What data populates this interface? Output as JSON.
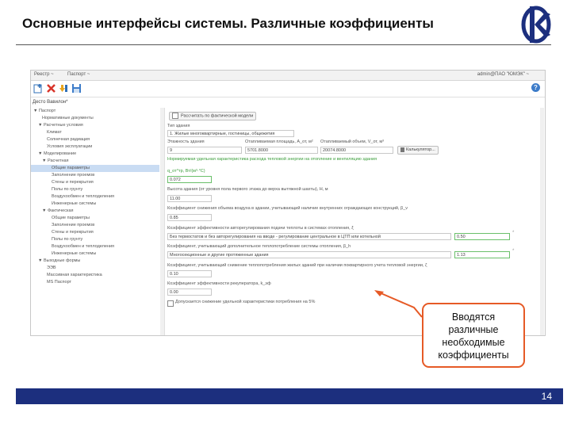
{
  "slide": {
    "title": "Основные интерфейсы системы. Различные коэффициенты",
    "page_number": "14",
    "callout_lines": [
      "Вводятся",
      "различные",
      "необходимые",
      "коэффициенты"
    ],
    "colors": {
      "accent": "#e65a26",
      "footer": "#1c2f7e",
      "logo": "#1c2f7e"
    }
  },
  "app": {
    "top_menu": [
      "Реестр ~",
      "Паспорт ~"
    ],
    "user": "admin@ПАО \"ЮМЭК\" ~",
    "toolbar_icons": [
      "add-icon",
      "delete-icon",
      "edit-icon",
      "save-icon"
    ],
    "document_title": "Десто Вавилон*"
  },
  "tree": [
    "▼ Паспорт",
    "Нормативные документы",
    "▼ Расчетные условия",
    "Климат",
    "Солнечная радиация",
    "Условия эксплуатации",
    "▼ Моделирование",
    "▼ Расчетная",
    "Общие параметры",
    "Заполнение проемов",
    "Стены и перекрытия",
    "Полы по грунту",
    "Воздухообмен и теплоделения",
    "Инженерные системы",
    "▼ Фактическая",
    "Общие параметры",
    "Заполнение проемов",
    "Стены и перекрытия",
    "Полы по грунту",
    "Воздухообмен и теплоделения",
    "Инженерные системы",
    "▼ Выходные формы",
    "ЭЭВ",
    "Массивная характеристика",
    "MS Паспорт"
  ],
  "form": {
    "calc_checkbox": "Рассчитать по фактической модели",
    "building_type_label": "Тип здания",
    "building_type_value": "1. Жилые многоквартирные, гостиницы, общежития",
    "floors_label": "Этажность здания",
    "area_label": "Отапливаемая площадь, A_от, м²",
    "volume_label": "Отапливаемый объем, V_от, м³",
    "floors_value": "9",
    "area_value": "5701.8000",
    "volume_value": "20074.8000",
    "calc_button": "Калькулятор...",
    "norm_label": "Нормируемая удельная характеристика расхода тепловой энергии на отопление и вентиляцию здания",
    "norm_sub": "q_от^тр, Вт/(м³·°С)",
    "norm_value": "0.072",
    "height_label": "Высота здания (от уровня пола первого этажа до верха вытяжной шахты), H, м",
    "height_value": "11.00",
    "coef_volume_label": "Коэффициент снижения объема воздуха в здании, учитывающий наличие внутренних ограждающих конструкций, β_v",
    "coef_volume_value": "0.85",
    "coef_auto_label": "Коэффициент эффективности авторегулирования подачи теплоты в системах отопления, ξ",
    "coef_auto_select": "Без термостатов и без авторегулирования на вводе - регулирование центральное в ЦТП или котельной",
    "coef_auto_value": "0.50",
    "coef_extra_label": "Коэффициент, учитывающий дополнительное теплопотребление системы отопления, β_h",
    "coef_extra_select": "Многосекционные и другие протяженные здания",
    "coef_extra_value": "1.13",
    "coef_reduce_label": "Коэффициент, учитывающий снижение теплопотребления жилых зданий при наличии поквартирного учета тепловой энергии, ζ",
    "coef_reduce_value": "0.10",
    "coef_recup_label": "Коэффициент эффективности рекуператора, k_эф",
    "coef_recup_value": "0.00",
    "allow_checkbox": "Допускается снижение удельной характеристики потребления на 5%"
  }
}
